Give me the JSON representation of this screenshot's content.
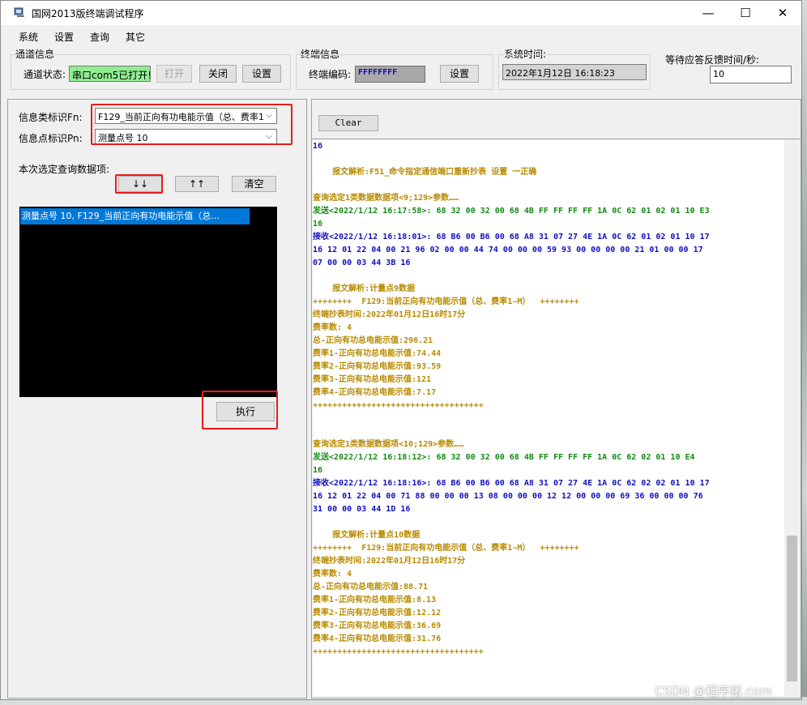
{
  "window": {
    "title": "国网2013版终端调试程序"
  },
  "controls": {
    "minimize": "—",
    "maximize": "☐",
    "close": "✕"
  },
  "menu": [
    "系统",
    "设置",
    "查询",
    "其它"
  ],
  "channel": {
    "group": "通道信息",
    "status_label": "通道状态:",
    "status_value": "串口com5已打开!",
    "open": "打开",
    "close": "关闭",
    "settings": "设置"
  },
  "terminal": {
    "group": "终端信息",
    "code_label": "终端编码:",
    "code_value": "FFFFFFFF",
    "settings": "设置"
  },
  "system_time": {
    "group": "系统时间:",
    "value": "2022年1月12日  16:18:23"
  },
  "response_wait": {
    "label": "等待应答反馈时间/秒:",
    "value": "10"
  },
  "query": {
    "fn_label": "信息类标识Fn:",
    "fn_value": "F129_当前正向有功电能示值（总、费率1",
    "pn_label": "信息点标识Pn:",
    "pn_value": "测量点号 10",
    "selected_label": "本次选定查询数据项:",
    "add": "↓↓",
    "remove": "↑↑",
    "clear": "清空",
    "list": [
      "测量点号 10, F129_当前正向有功电能示值（总..."
    ],
    "execute": "执行"
  },
  "log_panel": {
    "clear": "Clear",
    "lines": [
      {
        "text": "16",
        "color": "blue"
      },
      {
        "text": "",
        "color": "gold"
      },
      {
        "text": "    报文解析:F51_命令指定通信端口重新抄表 设置 一正确",
        "color": "gold"
      },
      {
        "text": "",
        "color": "gold"
      },
      {
        "text": "查询选定1类数据数据项<9;129>参数……",
        "color": "gold"
      },
      {
        "text": "发送<2022/1/12 16:17:58>: 68 32 00 32 00 68 4B FF FF FF FF 1A 0C 62 01 02 01 10 E3",
        "color": "green"
      },
      {
        "text": "16",
        "color": "green"
      },
      {
        "text": "接收<2022/1/12 16:18:01>: 68 B6 00 B6 00 68 A8 31 07 27 4E 1A 0C 62 01 02 01 10 17",
        "color": "blue"
      },
      {
        "text": "16 12 01 22 04 00 21 96 02 00 00 44 74 00 00 00 59 93 00 00 00 00 21 01 00 00 17",
        "color": "blue"
      },
      {
        "text": "07 00 00 03 44 3B 16",
        "color": "blue"
      },
      {
        "text": "",
        "color": "gold"
      },
      {
        "text": "    报文解析:计量点9数据",
        "color": "gold"
      },
      {
        "text": "++++++++  F129:当前正向有功电能示值（总、费率1~M）  ++++++++",
        "color": "gold"
      },
      {
        "text": "终端抄表时间:2022年01月12日16时17分",
        "color": "gold"
      },
      {
        "text": "费率数: 4",
        "color": "gold"
      },
      {
        "text": "总-正向有功总电能示值:296.21",
        "color": "gold"
      },
      {
        "text": "费率1-正向有功总电能示值:74.44",
        "color": "gold"
      },
      {
        "text": "费率2-正向有功总电能示值:93.59",
        "color": "gold"
      },
      {
        "text": "费率3-正向有功总电能示值:121",
        "color": "gold"
      },
      {
        "text": "费率4-正向有功总电能示值:7.17",
        "color": "gold"
      },
      {
        "text": "+++++++++++++++++++++++++++++++++++",
        "color": "gold"
      },
      {
        "text": "",
        "color": "gold"
      },
      {
        "text": "",
        "color": "gold"
      },
      {
        "text": "查询选定1类数据数据项<10;129>参数……",
        "color": "gold"
      },
      {
        "text": "发送<2022/1/12 16:18:12>: 68 32 00 32 00 68 4B FF FF FF FF 1A 0C 62 02 01 10 E4",
        "color": "green"
      },
      {
        "text": "16",
        "color": "green"
      },
      {
        "text": "接收<2022/1/12 16:18:16>: 68 B6 00 B6 00 68 A8 31 07 27 4E 1A 0C 62 02 02 01 10 17",
        "color": "blue"
      },
      {
        "text": "16 12 01 22 04 00 71 88 00 00 00 13 08 00 00 00 12 12 00 00 00 69 36 00 00 00 76",
        "color": "blue"
      },
      {
        "text": "31 00 00 03 44 1D 16",
        "color": "blue"
      },
      {
        "text": "",
        "color": "gold"
      },
      {
        "text": "    报文解析:计量点10数据",
        "color": "gold"
      },
      {
        "text": "++++++++  F129:当前正向有功电能示值（总、费率1~M）  ++++++++",
        "color": "gold"
      },
      {
        "text": "终端抄表时间:2022年01月12日16时17分",
        "color": "gold"
      },
      {
        "text": "费率数: 4",
        "color": "gold"
      },
      {
        "text": "总-正向有功总电能示值:88.71",
        "color": "gold"
      },
      {
        "text": "费率1-正向有功总电能示值:8.13",
        "color": "gold"
      },
      {
        "text": "费率2-正向有功总电能示值:12.12",
        "color": "gold"
      },
      {
        "text": "费率3-正向有功总电能示值:36.69",
        "color": "gold"
      },
      {
        "text": "费率4-正向有功总电能示值:31.76",
        "color": "gold"
      },
      {
        "text": "+++++++++++++++++++++++++++++++++++",
        "color": "gold"
      }
    ]
  },
  "watermark": "CSDN @程序猪.com"
}
